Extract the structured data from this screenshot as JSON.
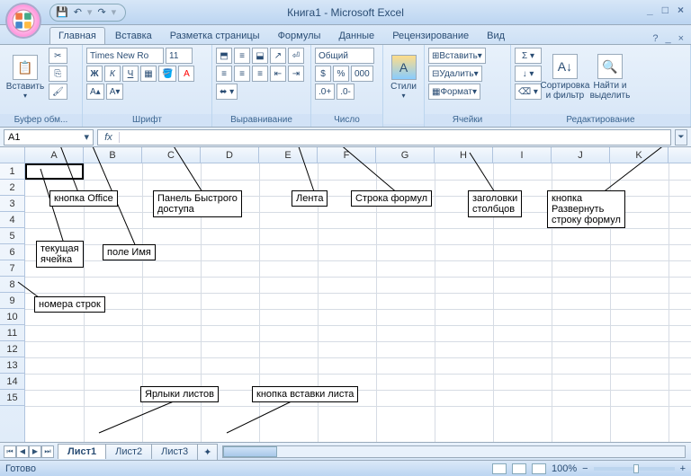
{
  "title": "Книга1 - Microsoft Excel",
  "qat": {
    "save": "💾",
    "undo": "↶",
    "redo": "↷"
  },
  "tabs": [
    "Главная",
    "Вставка",
    "Разметка страницы",
    "Формулы",
    "Данные",
    "Рецензирование",
    "Вид"
  ],
  "active_tab": 0,
  "ribbon": {
    "clipboard": {
      "label": "Буфер обм...",
      "paste": "Вставить"
    },
    "font": {
      "label": "Шрифт",
      "name": "Times New Ro",
      "size": "11"
    },
    "alignment": {
      "label": "Выравнивание"
    },
    "number": {
      "label": "Число",
      "format": "Общий"
    },
    "styles": {
      "label": "",
      "btn": "Стили"
    },
    "cells": {
      "label": "Ячейки",
      "insert": "Вставить",
      "delete": "Удалить",
      "format": "Формат"
    },
    "editing": {
      "label": "Редактирование",
      "sort": "Сортировка\nи фильтр",
      "find": "Найти и\nвыделить"
    }
  },
  "namebox": "A1",
  "fx": "fx",
  "columns": [
    "A",
    "B",
    "C",
    "D",
    "E",
    "F",
    "G",
    "H",
    "I",
    "J",
    "K"
  ],
  "rows_visible": 15,
  "annotations": {
    "office": "кнопка Office",
    "qat_panel": "Панель Быстрого\nдоступа",
    "ribbon_a": "Лента",
    "formula_row": "Строка формул",
    "col_headers": "заголовки\nстолбцов",
    "expand_fx": "кнопка\nРазвернуть\nстроку формул",
    "cur_cell": "текущая\nячейка",
    "namebox_a": "поле Имя",
    "row_numbers": "номера строк",
    "sheet_tabs": "Ярлыки листов",
    "insert_sheet": "кнопка вставки листа"
  },
  "sheets": [
    "Лист1",
    "Лист2",
    "Лист3"
  ],
  "active_sheet": 0,
  "status": {
    "ready": "Готово",
    "zoom": "100%"
  }
}
